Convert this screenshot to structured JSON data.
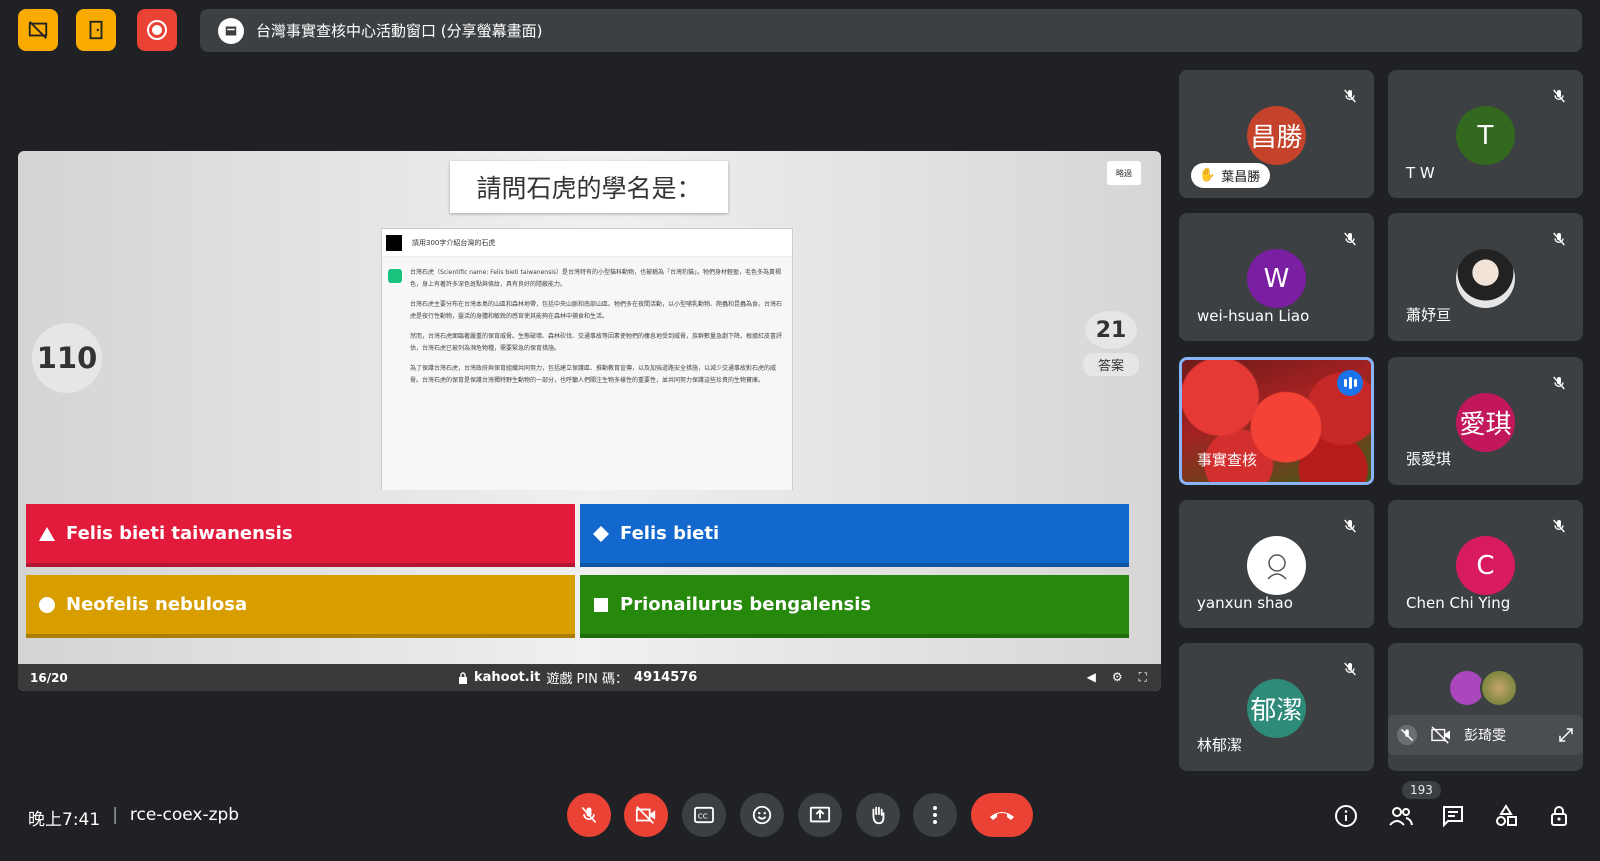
{
  "top_bar": {
    "banner_title": "台灣事實查核中心活動窗口 (分享螢幕畫面)"
  },
  "quiz": {
    "question": "請問石虎的學名是：",
    "skip_label": "略過",
    "timer": "110",
    "answer_count": "21",
    "answer_label": "答案",
    "chat_question": "請用300字介紹台灣的石虎",
    "chat_answer_paragraphs": [
      "台灣石虎（Scientific name: Felis bieti taiwanensis）是台灣特有的小型貓科動物，也被稱為「台灣豹貓」。牠們身材輕盈，毛色多為黃褐色，身上有著許多深色斑點與條紋，具有良好的隱蔽能力。",
      "台灣石虎主要分布在台灣本島的山區和森林地帶，包括中央山脈和南部山區。牠們多在夜間活動，以小型哺乳動物、爬蟲和昆蟲為食。台灣石虎是夜行性動物，靈活的身體和敏銳的感官使其能夠在森林中捕食和生活。",
      "然而，台灣石虎面臨著嚴重的保育威脅。生態破壞、森林砍伐、交通事故等因素使牠們的棲息地受到威脅，族群數量急劇下降。根據紅皮書評估，台灣石虎已被列為瀕危物種，需要緊急的保育措施。",
      "為了保護台灣石虎，台灣政府與保育組織共同努力，包括建立保護區、推動教育宣傳，以及加強道路安全措施，以減少交通事故對石虎的威脅。台灣石虎的保育是保護台灣獨特野生動物的一部分，也呼籲人們關注生物多樣性的重要性，並共同努力保護這些珍貴的生物寶庫。"
    ],
    "answers": [
      {
        "text": "Felis bieti taiwanensis",
        "shape": "triangle"
      },
      {
        "text": "Felis bieti",
        "shape": "diamond"
      },
      {
        "text": "Neofelis nebulosa",
        "shape": "circle"
      },
      {
        "text": "Prionailurus bengalensis",
        "shape": "square"
      }
    ],
    "progress": "16/20",
    "site": "kahoot.it",
    "pin_label": "遊戲 PIN 碼：",
    "pin": "4914576"
  },
  "participants": [
    {
      "name": "葉昌勝",
      "avatar_text": "昌勝",
      "color": "#c5432b",
      "muted": true,
      "hand_raised": true
    },
    {
      "name": "T W",
      "avatar_text": "T",
      "color": "#33691e",
      "muted": true
    },
    {
      "name": "wei-hsuan Liao",
      "avatar_text": "W",
      "color": "#7b1fa2",
      "muted": true
    },
    {
      "name": "蕭妤亘",
      "avatar_text": "",
      "color": "#cfcfcf",
      "muted": true
    },
    {
      "name": "事實查核",
      "avatar_text": "",
      "color": "#c62828",
      "muted": false,
      "speaking": true
    },
    {
      "name": "張愛琪",
      "avatar_text": "愛琪",
      "color": "#c2185b",
      "muted": true
    },
    {
      "name": "yanxun shao",
      "avatar_text": "",
      "color": "#ffffff",
      "muted": true
    },
    {
      "name": "Chen Chi Ying",
      "avatar_text": "C",
      "color": "#d81b60",
      "muted": true
    },
    {
      "name": "林郁潔",
      "avatar_text": "郁潔",
      "color": "#2e8b7a",
      "muted": true
    },
    {
      "name": "彭琦雯",
      "avatar_text": "",
      "color": "#ab47bc",
      "muted": true
    }
  ],
  "bottom_bar": {
    "time": "晚上7:41",
    "meeting_code": "rce-coex-zpb",
    "participant_count": "193"
  },
  "colors": {
    "background": "#202124",
    "tile": "#3c4043",
    "danger": "#ea4335",
    "warning": "#f9ab00"
  }
}
